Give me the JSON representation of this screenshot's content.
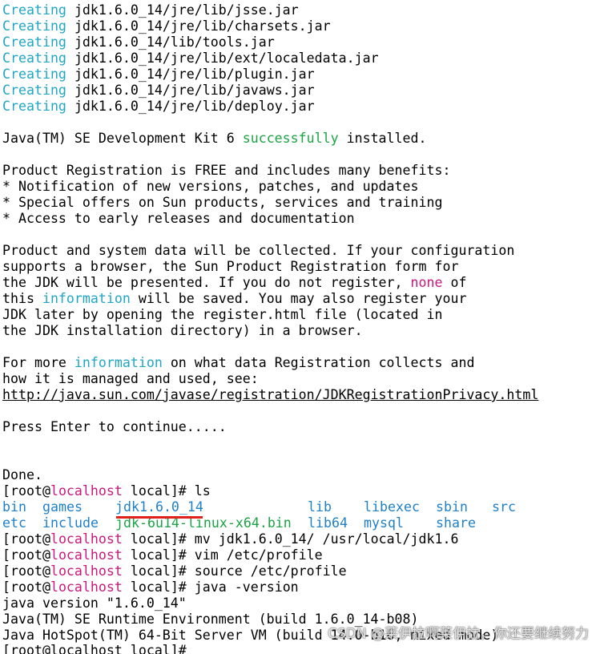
{
  "creating": {
    "keyword": "Creating",
    "paths": [
      "jdk1.6.0_14/jre/lib/jsse.jar",
      "jdk1.6.0_14/jre/lib/charsets.jar",
      "jdk1.6.0_14/lib/tools.jar",
      "jdk1.6.0_14/jre/lib/ext/localedata.jar",
      "jdk1.6.0_14/jre/lib/plugin.jar",
      "jdk1.6.0_14/jre/lib/javaws.jar",
      "jdk1.6.0_14/jre/lib/deploy.jar"
    ]
  },
  "install": {
    "pre": "Java(TM) SE Development Kit 6 ",
    "word": "successfully",
    "post": " installed."
  },
  "reg": {
    "l1": "Product Registration is FREE and includes many benefits:",
    "l2": "* Notification of new versions, patches, and updates",
    "l3": "* Special offers on Sun products, services and training",
    "l4": "* Access to early releases and documentation"
  },
  "collect": {
    "l1": "Product and system data will be collected. If your configuration",
    "l2": "supports a browser, the Sun Product Registration form for",
    "l3a": "the JDK will be presented. If you do not register, ",
    "l3b": "none",
    "l3c": " of",
    "l4a": "this ",
    "l4b": "information",
    "l4c": " will be saved. You may also register your",
    "l5": "JDK later by opening the register.html file (located in",
    "l6": "the JDK installation directory) in a browser."
  },
  "more": {
    "l1a": "For more ",
    "l1b": "information",
    "l1c": " on what data Registration collects and",
    "l2": "how it is managed and used, see:",
    "url": "http://java.sun.com/javase/registration/JDKRegistrationPrivacy.html"
  },
  "press": "Press Enter to continue.....",
  "done": "Done.",
  "prompt": {
    "open": "[root@",
    "host": "localhost",
    "dir": " local]# "
  },
  "commands": {
    "ls": "ls",
    "mv": "mv jdk1.6.0_14/ /usr/local/jdk1.6",
    "vim": "vim /etc/profile",
    "source": "source /etc/profile",
    "java": "java -version"
  },
  "ls_output": {
    "row1": [
      "bin",
      "games",
      "jdk1.6.0_14",
      "lib",
      "libexec",
      "sbin",
      "src"
    ],
    "row2": [
      "etc",
      "include",
      "jdk-6u14-linux-x64.bin",
      "lib64",
      "mysql",
      "share"
    ]
  },
  "java_output": {
    "l1": "java version \"1.6.0_14\"",
    "l2": "Java(TM) SE Runtime Environment (build 1.6.0_14-b08)",
    "l3": "Java HotSpot(TM) 64-Bit Server VM (build 14.0-b16, mixed mode)",
    "l4": "[root@localhost local]# "
  },
  "colors": {
    "cyan": "#21a6c1",
    "magenta": "#c5197c",
    "green": "#1ba345",
    "blue": "#1f80c7",
    "annotation_red": "#e0201a"
  },
  "watermark": "CSDN @莱伊拉啊莱伊拉，你还要继续努力"
}
